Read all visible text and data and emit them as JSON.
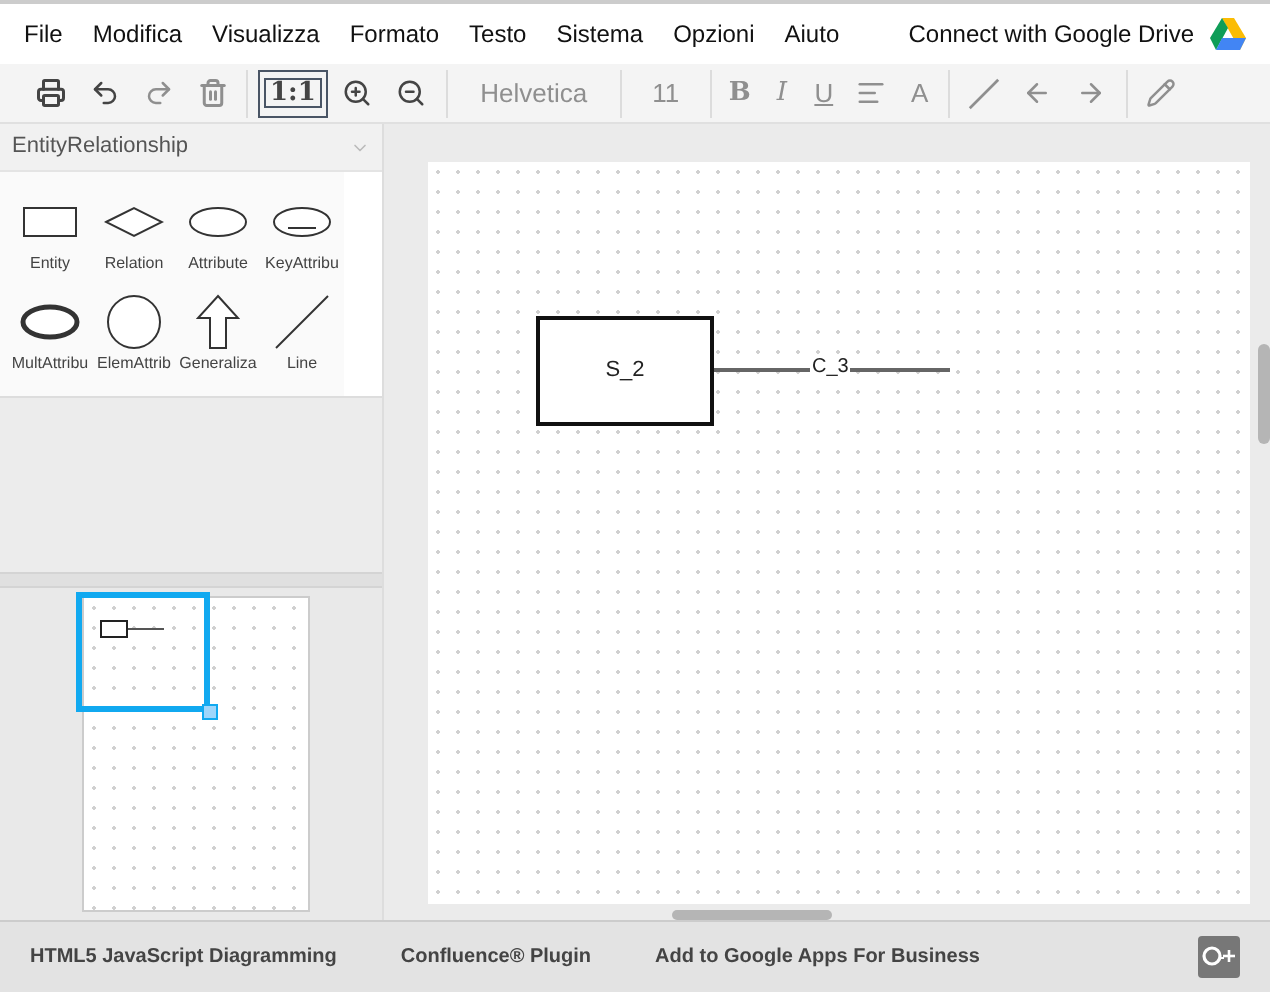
{
  "menu": [
    "File",
    "Modifica",
    "Visualizza",
    "Formato",
    "Testo",
    "Sistema",
    "Opzioni",
    "Aiuto"
  ],
  "drive_link": "Connect with Google Drive",
  "toolbar": [
    [
      {
        "kind": "print",
        "disabled": false
      },
      {
        "kind": "undo",
        "disabled": false
      },
      {
        "kind": "redo",
        "disabled": true
      },
      {
        "kind": "delete",
        "disabled": true
      }
    ],
    [
      {
        "kind": "actual-size",
        "text": "1:1",
        "disabled": false
      },
      {
        "kind": "zoom-in",
        "disabled": false
      },
      {
        "kind": "zoom-out",
        "disabled": false
      }
    ],
    [
      {
        "kind": "font",
        "text": "Helvetica",
        "disabled": true
      }
    ],
    [
      {
        "kind": "size",
        "text": "11",
        "disabled": true
      }
    ],
    [
      {
        "kind": "bold",
        "text": "B",
        "disabled": true
      },
      {
        "kind": "italic",
        "text": "I",
        "disabled": true
      },
      {
        "kind": "underline",
        "text": "U",
        "disabled": true
      },
      {
        "kind": "align",
        "disabled": true
      },
      {
        "kind": "font-color",
        "text": "A",
        "disabled": true
      }
    ],
    [
      {
        "kind": "line",
        "disabled": true
      },
      {
        "kind": "arrow-left",
        "disabled": true
      },
      {
        "kind": "arrow-right",
        "disabled": true
      }
    ],
    [
      {
        "kind": "pencil",
        "disabled": true
      }
    ]
  ],
  "palette": {
    "title": "EntityRelationship",
    "expanded": true,
    "shapes": [
      {
        "kind": "entity",
        "label": "Entity"
      },
      {
        "kind": "relation",
        "label": "Relation"
      },
      {
        "kind": "attribute",
        "label": "Attribute"
      },
      {
        "kind": "key-attribute",
        "label": "KeyAttribu"
      },
      {
        "kind": "multi-attribute",
        "label": "MultAttribu"
      },
      {
        "kind": "elem-attribute",
        "label": "ElemAttrib"
      },
      {
        "kind": "generalization",
        "label": "Generaliza"
      },
      {
        "kind": "line",
        "label": "Line"
      }
    ]
  },
  "diagram": {
    "entity": {
      "label": "S_2"
    },
    "connector": {
      "label": "C_3"
    }
  },
  "footer": [
    "HTML5 JavaScript Diagramming",
    "Confluence® Plugin",
    "Add to Google Apps For Business"
  ]
}
